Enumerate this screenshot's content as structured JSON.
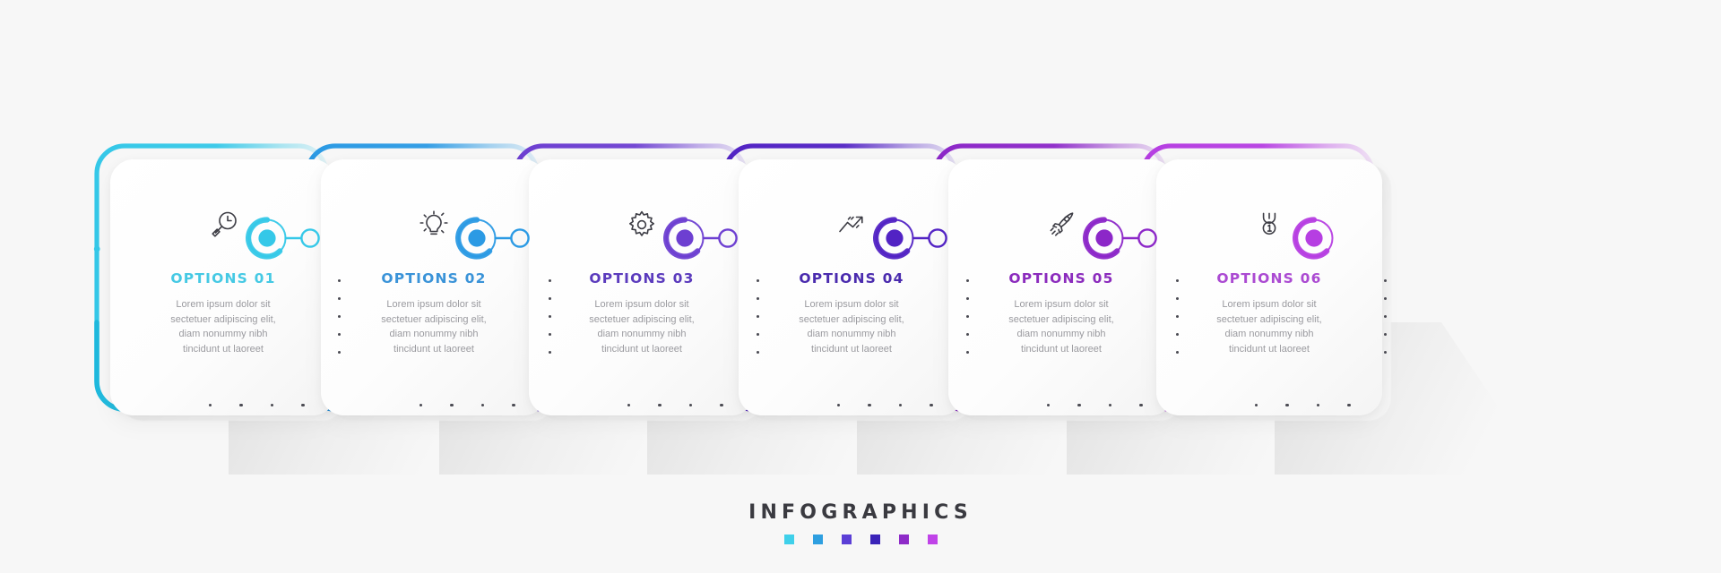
{
  "footer": {
    "title": "INFOGRAPHICS",
    "swatches": [
      "#3fd0ea",
      "#2e9fe0",
      "#5b3fd6",
      "#3a23b8",
      "#8e2bc8",
      "#c043e8"
    ]
  },
  "body_text": "Lorem ipsum dolor sit sectetuer adipiscing elit, diam nonummy nibh tincidunt ut laoreet",
  "steps": [
    {
      "label": "OPTIONS 01",
      "desc_line1": "Lorem ipsum dolor sit",
      "desc_line2": "sectetuer adipiscing elit,",
      "desc_line3": "diam nonummy nibh",
      "desc_line4": "tincidunt ut laoreet",
      "icon": "magnifier-clock-icon",
      "color": "#35c8e8",
      "color_dark": "#1fb9dd",
      "title_color": "#45c9e4"
    },
    {
      "label": "OPTIONS 02",
      "desc_line1": "Lorem ipsum dolor sit",
      "desc_line2": "sectetuer adipiscing elit,",
      "desc_line3": "diam nonummy nibh",
      "desc_line4": "tincidunt ut laoreet",
      "icon": "lightbulb-icon",
      "color": "#2b9ae4",
      "color_dark": "#1a86d4",
      "title_color": "#3a93d8"
    },
    {
      "label": "OPTIONS 03",
      "desc_line1": "Lorem ipsum dolor sit",
      "desc_line2": "sectetuer adipiscing elit,",
      "desc_line3": "diam nonummy nibh",
      "desc_line4": "tincidunt ut laoreet",
      "icon": "gear-icon",
      "color": "#6d3fd1",
      "color_dark": "#5a2ec2",
      "title_color": "#5b3bbd"
    },
    {
      "label": "OPTIONS 04",
      "desc_line1": "Lorem ipsum dolor sit",
      "desc_line2": "sectetuer adipiscing elit,",
      "desc_line3": "diam nonummy nibh",
      "desc_line4": "tincidunt ut laoreet",
      "icon": "trending-up-icon",
      "color": "#5223c4",
      "color_dark": "#4316b2",
      "title_color": "#4a2bae"
    },
    {
      "label": "OPTIONS 05",
      "desc_line1": "Lorem ipsum dolor sit",
      "desc_line2": "sectetuer adipiscing elit,",
      "desc_line3": "diam nonummy nibh",
      "desc_line4": "tincidunt ut laoreet",
      "icon": "rocket-icon",
      "color": "#8c27c8",
      "color_dark": "#7a17b6",
      "title_color": "#8b2bbd"
    },
    {
      "label": "OPTIONS 06",
      "desc_line1": "Lorem ipsum dolor sit",
      "desc_line2": "sectetuer adipiscing elit,",
      "desc_line3": "diam nonummy nibh",
      "desc_line4": "tincidunt ut laoreet",
      "icon": "medal-icon",
      "color": "#b63ee2",
      "color_dark": "#a62cd4",
      "title_color": "#ab4ad2"
    }
  ]
}
